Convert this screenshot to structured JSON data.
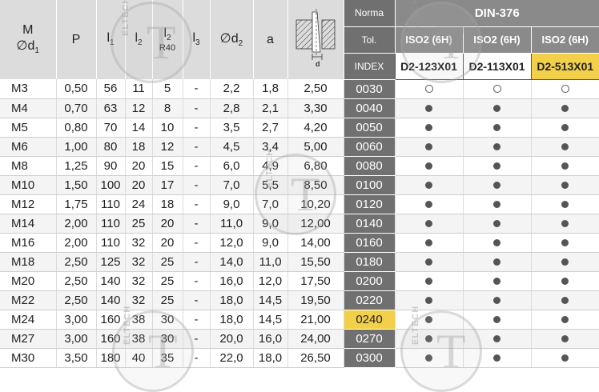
{
  "header": {
    "col_m": "M",
    "col_d1": "∅d",
    "col_d1_sub": "1",
    "col_p": "P",
    "col_l1": "l",
    "col_l1_sub": "1",
    "col_l2": "l",
    "col_l2_sub": "2",
    "col_l2r": "l",
    "col_l2r_sub": "2",
    "col_l2r_note": "R40",
    "col_l3": "l",
    "col_l3_sub": "3",
    "col_d2": "∅d",
    "col_d2_sub": "2",
    "col_a": "a",
    "icon_label": "d",
    "norma_label": "Norma",
    "norma_value": "DIN-376",
    "tol_label": "Tol.",
    "tolerances": [
      "ISO2 (6H)",
      "ISO2 (6H)",
      "ISO2 (6H)"
    ],
    "index_label": "INDEX",
    "codes": [
      "D2-123X01",
      "D2-113X01",
      "D2-513X01"
    ]
  },
  "watermark_text": "ELTECH",
  "watermark_letter": "T",
  "rows": [
    {
      "m": "M3",
      "p": "0,50",
      "l1": "56",
      "l2": "11",
      "l2r": "5",
      "l3": "-",
      "d2": "2,2",
      "a": "1,8",
      "d": "2,50",
      "index": "0030",
      "marks": [
        "open",
        "open",
        "open"
      ]
    },
    {
      "m": "M4",
      "p": "0,70",
      "l1": "63",
      "l2": "12",
      "l2r": "8",
      "l3": "-",
      "d2": "2,8",
      "a": "2,1",
      "d": "3,30",
      "index": "0040",
      "marks": [
        "full",
        "full",
        "full"
      ]
    },
    {
      "m": "M5",
      "p": "0,80",
      "l1": "70",
      "l2": "14",
      "l2r": "10",
      "l3": "-",
      "d2": "3,5",
      "a": "2,7",
      "d": "4,20",
      "index": "0050",
      "marks": [
        "full",
        "full",
        "full"
      ]
    },
    {
      "m": "M6",
      "p": "1,00",
      "l1": "80",
      "l2": "18",
      "l2r": "12",
      "l3": "-",
      "d2": "4,5",
      "a": "3,4",
      "d": "5,00",
      "index": "0060",
      "marks": [
        "full",
        "full",
        "full"
      ]
    },
    {
      "m": "M8",
      "p": "1,25",
      "l1": "90",
      "l2": "20",
      "l2r": "15",
      "l3": "-",
      "d2": "6,0",
      "a": "4,9",
      "d": "6,80",
      "index": "0080",
      "marks": [
        "full",
        "full",
        "full"
      ]
    },
    {
      "m": "M10",
      "p": "1,50",
      "l1": "100",
      "l2": "20",
      "l2r": "17",
      "l3": "-",
      "d2": "7,0",
      "a": "5,5",
      "d": "8,50",
      "index": "0100",
      "marks": [
        "full",
        "full",
        "full"
      ]
    },
    {
      "m": "M12",
      "p": "1,75",
      "l1": "110",
      "l2": "24",
      "l2r": "18",
      "l3": "-",
      "d2": "9,0",
      "a": "7,0",
      "d": "10,20",
      "index": "0120",
      "marks": [
        "full",
        "full",
        "full"
      ]
    },
    {
      "m": "M14",
      "p": "2,00",
      "l1": "110",
      "l2": "25",
      "l2r": "20",
      "l3": "-",
      "d2": "11,0",
      "a": "9,0",
      "d": "12,00",
      "index": "0140",
      "marks": [
        "full",
        "full",
        "full"
      ]
    },
    {
      "m": "M16",
      "p": "2,00",
      "l1": "110",
      "l2": "32",
      "l2r": "20",
      "l3": "-",
      "d2": "12,0",
      "a": "9,0",
      "d": "14,00",
      "index": "0160",
      "marks": [
        "full",
        "full",
        "full"
      ]
    },
    {
      "m": "M18",
      "p": "2,50",
      "l1": "125",
      "l2": "32",
      "l2r": "25",
      "l3": "-",
      "d2": "14,0",
      "a": "11,0",
      "d": "15,50",
      "index": "0180",
      "marks": [
        "full",
        "full",
        "full"
      ]
    },
    {
      "m": "M20",
      "p": "2,50",
      "l1": "140",
      "l2": "32",
      "l2r": "25",
      "l3": "-",
      "d2": "16,0",
      "a": "12,0",
      "d": "17,50",
      "index": "0200",
      "marks": [
        "full",
        "full",
        "full"
      ]
    },
    {
      "m": "M22",
      "p": "2,50",
      "l1": "140",
      "l2": "32",
      "l2r": "25",
      "l3": "-",
      "d2": "18,0",
      "a": "14,5",
      "d": "19,50",
      "index": "0220",
      "marks": [
        "full",
        "full",
        "full"
      ]
    },
    {
      "m": "M24",
      "p": "3,00",
      "l1": "160",
      "l2": "38",
      "l2r": "30",
      "l3": "-",
      "d2": "18,0",
      "a": "14,5",
      "d": "21,00",
      "index": "0240",
      "highlight": true,
      "marks": [
        "full",
        "full",
        "full"
      ]
    },
    {
      "m": "M27",
      "p": "3,00",
      "l1": "160",
      "l2": "38",
      "l2r": "30",
      "l3": "-",
      "d2": "20,0",
      "a": "16,0",
      "d": "24,00",
      "index": "0270",
      "marks": [
        "full",
        "full",
        "full"
      ]
    },
    {
      "m": "M30",
      "p": "3,50",
      "l1": "180",
      "l2": "40",
      "l2r": "35",
      "l3": "-",
      "d2": "22,0",
      "a": "18,0",
      "d": "26,50",
      "index": "0300",
      "marks": [
        "full",
        "full",
        "full"
      ]
    }
  ]
}
